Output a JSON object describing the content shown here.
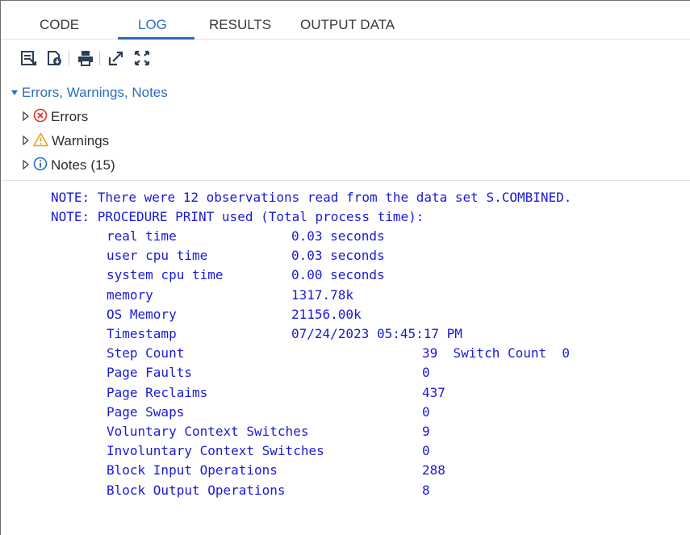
{
  "tabs": [
    {
      "label": "CODE",
      "active": false
    },
    {
      "label": "LOG",
      "active": true
    },
    {
      "label": "RESULTS",
      "active": false
    },
    {
      "label": "OUTPUT DATA",
      "active": false
    }
  ],
  "toolbar": {
    "icons": [
      "save-log-icon",
      "download-log-icon",
      "print-icon",
      "open-in-new-window-icon",
      "maximize-icon"
    ]
  },
  "tree": {
    "section_label": "Errors, Warnings, Notes",
    "errors_label": "Errors",
    "warnings_label": "Warnings",
    "notes_label": "Notes",
    "notes_count": "(15)"
  },
  "colors": {
    "accent": "#2a6ebb",
    "log_text": "#1a1ad6",
    "error": "#d9332b",
    "warning": "#e8a317",
    "info": "#1f6fc5"
  },
  "log": {
    "note1": "NOTE: There were 12 observations read from the data set S.COMBINED.",
    "note2": "NOTE: PROCEDURE PRINT used (Total process time):",
    "stats": [
      {
        "label": "real time",
        "value": "0.03 seconds",
        "col": 1
      },
      {
        "label": "user cpu time",
        "value": "0.03 seconds",
        "col": 1
      },
      {
        "label": "system cpu time",
        "value": "0.00 seconds",
        "col": 1
      },
      {
        "label": "memory",
        "value": "1317.78k",
        "col": 1
      },
      {
        "label": "OS Memory",
        "value": "21156.00k",
        "col": 1
      },
      {
        "label": "Timestamp",
        "value": "07/24/2023 05:45:17 PM",
        "col": 1
      },
      {
        "label": "Step Count",
        "value": "39  Switch Count  0",
        "col": 2
      },
      {
        "label": "Page Faults",
        "value": "0",
        "col": 2
      },
      {
        "label": "Page Reclaims",
        "value": "437",
        "col": 2
      },
      {
        "label": "Page Swaps",
        "value": "0",
        "col": 2
      },
      {
        "label": "Voluntary Context Switches",
        "value": "9",
        "col": 2
      },
      {
        "label": "Involuntary Context Switches",
        "value": "0",
        "col": 2
      },
      {
        "label": "Block Input Operations",
        "value": "288",
        "col": 2
      },
      {
        "label": "Block Output Operations",
        "value": "8",
        "col": 2
      }
    ]
  }
}
